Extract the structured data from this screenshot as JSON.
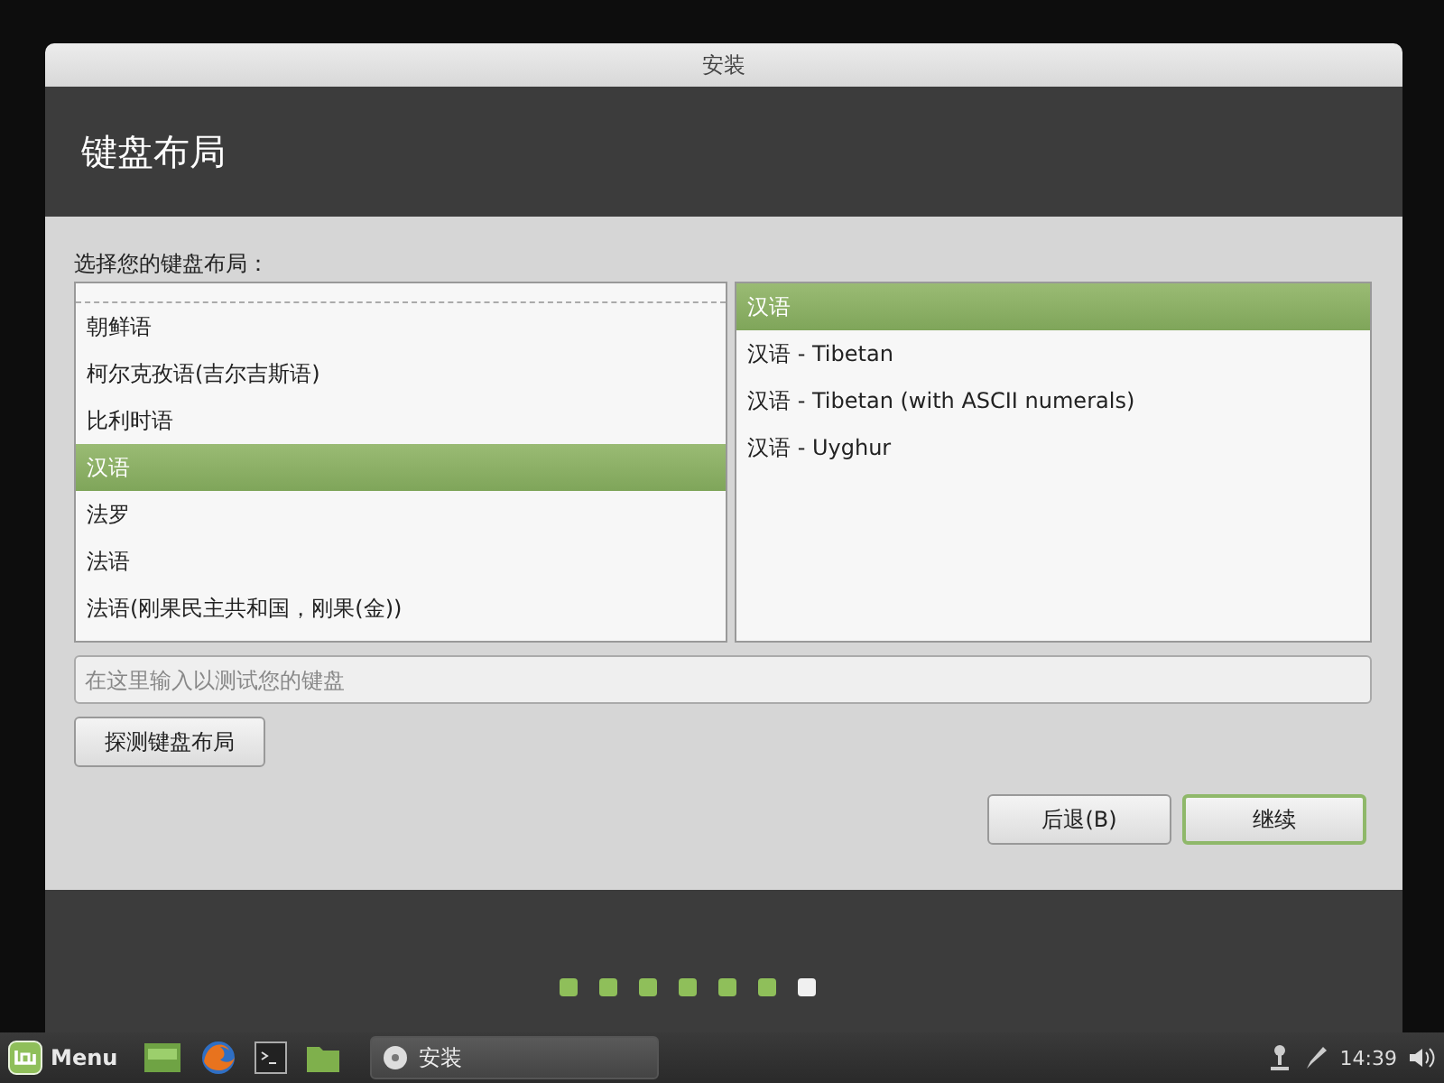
{
  "window": {
    "title": "安装"
  },
  "header": {
    "title": "键盘布局"
  },
  "prompt": "选择您的键盘布局：",
  "layouts": [
    {
      "label": "朝鲜语",
      "selected": false
    },
    {
      "label": "柯尔克孜语(吉尔吉斯语)",
      "selected": false
    },
    {
      "label": "比利时语",
      "selected": false
    },
    {
      "label": "汉语",
      "selected": true
    },
    {
      "label": "法罗",
      "selected": false
    },
    {
      "label": "法语",
      "selected": false
    },
    {
      "label": "法语(刚果民主共和国，刚果(金))",
      "selected": false
    }
  ],
  "variants": [
    {
      "label": "汉语",
      "selected": true
    },
    {
      "label": "汉语 - Tibetan",
      "selected": false
    },
    {
      "label": "汉语 - Tibetan (with ASCII numerals)",
      "selected": false
    },
    {
      "label": "汉语 - Uyghur",
      "selected": false
    }
  ],
  "test_field": {
    "placeholder": "在这里输入以测试您的键盘"
  },
  "detect_button": "探测键盘布局",
  "buttons": [
    {
      "label": "后退(B)",
      "kind": "back"
    },
    {
      "label": "继续",
      "kind": "next"
    }
  ],
  "steps": [
    {
      "selected": false
    },
    {
      "selected": false
    },
    {
      "selected": false
    },
    {
      "selected": false
    },
    {
      "selected": false
    },
    {
      "selected": false
    },
    {
      "selected": true
    }
  ],
  "taskbar": {
    "menu": "Menu",
    "windows": [
      {
        "label": "安装"
      }
    ],
    "clock": "14:39"
  }
}
